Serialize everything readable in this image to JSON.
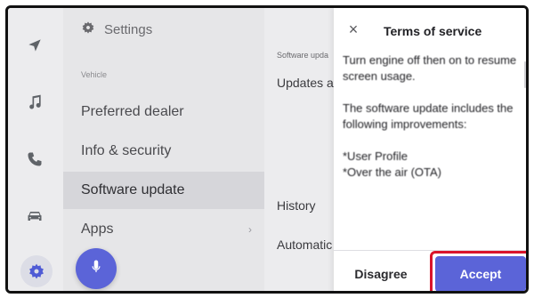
{
  "rail": {
    "icons": [
      "navigation-icon",
      "music-icon",
      "phone-icon",
      "car-icon",
      "settings-icon"
    ],
    "active": "settings-icon"
  },
  "menu": {
    "title": "Settings",
    "section_label": "Vehicle",
    "items": [
      {
        "label": "Preferred dealer",
        "selected": false
      },
      {
        "label": "Info & security",
        "selected": false
      },
      {
        "label": "Software update",
        "selected": true
      },
      {
        "label": "Apps",
        "selected": false,
        "has_chevron": true
      }
    ],
    "apps_chevron": "›"
  },
  "content": {
    "section_label": "Software upda",
    "updates_label": "Updates a",
    "history_label": "History",
    "automatic_label": "Automatic"
  },
  "dialog": {
    "close_glyph": "×",
    "title": "Terms of service",
    "paragraphs": [
      "Turn engine off then on to resume screen usage.",
      "The software update includes the following improvements:",
      "*User Profile\n*Over the air (OTA)"
    ],
    "disagree_label": "Disagree",
    "accept_label": "Accept"
  },
  "colors": {
    "accent": "#5b64d8",
    "highlight_border": "#d9142b"
  }
}
